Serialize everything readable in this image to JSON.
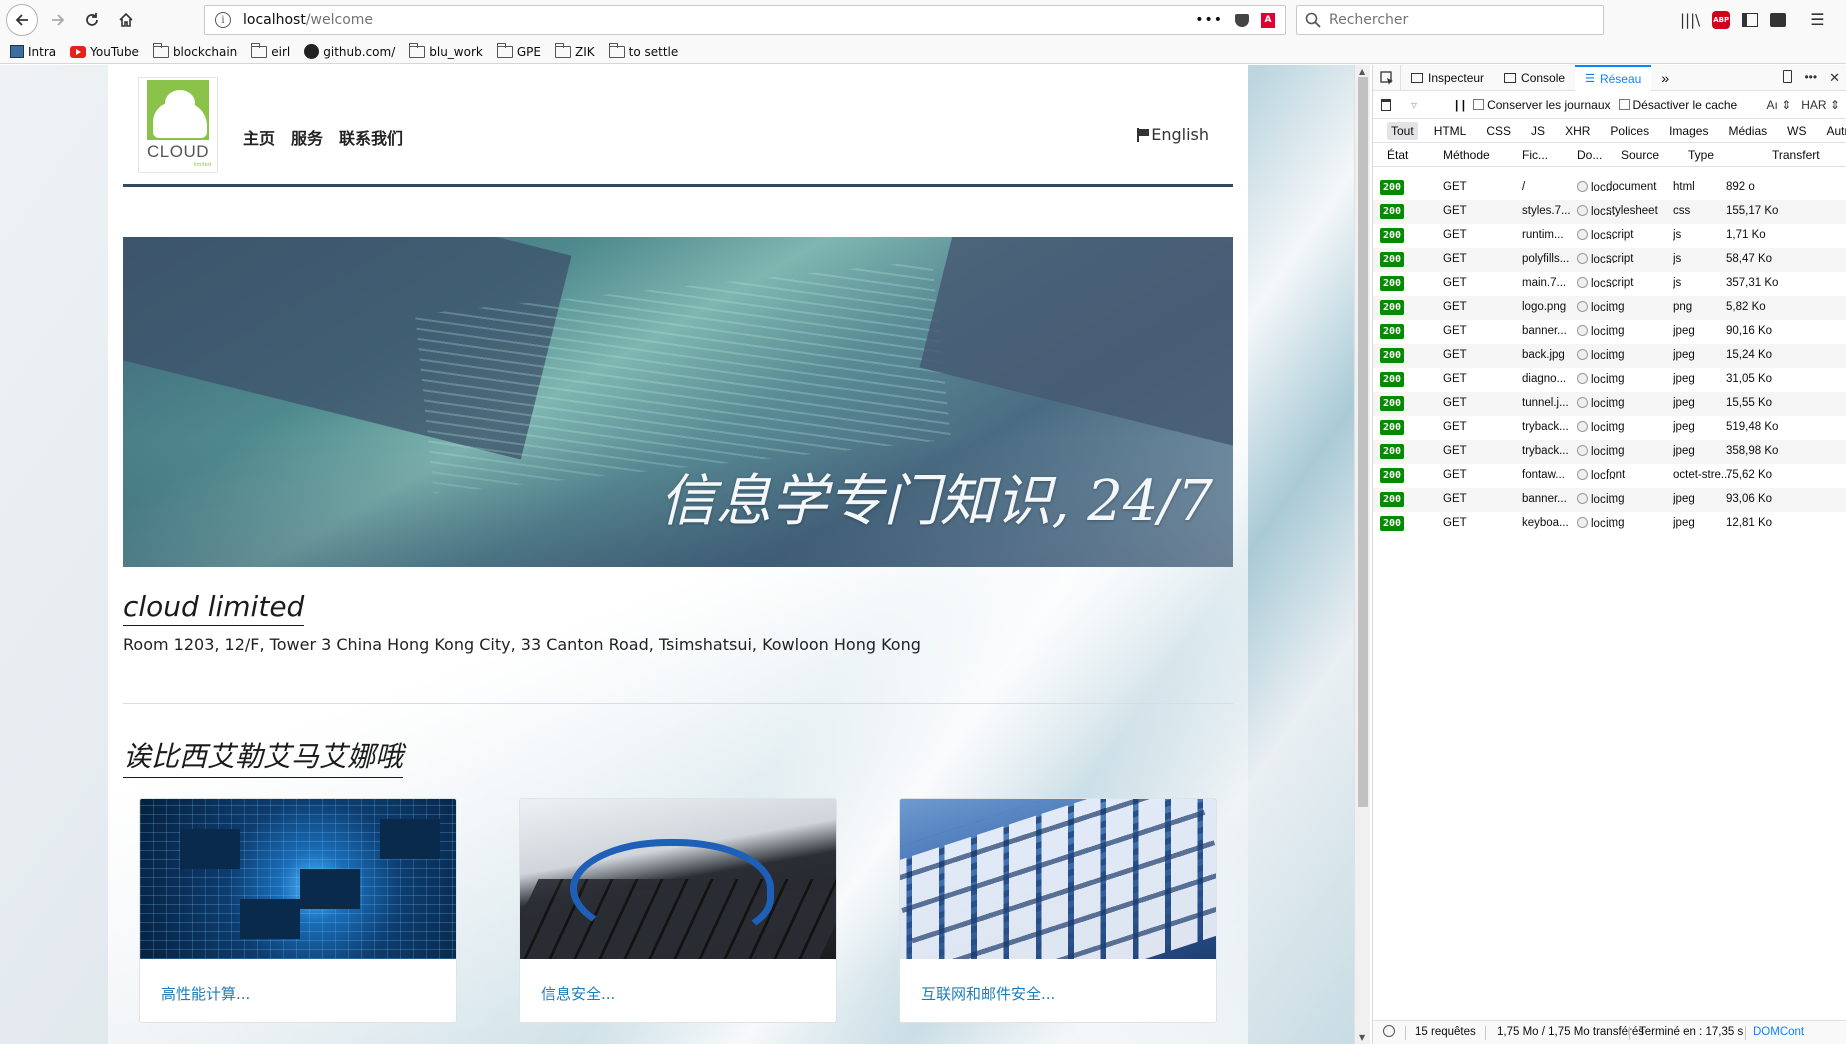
{
  "browser": {
    "url_host": "localhost",
    "url_path": "/welcome",
    "search_placeholder": "Rechercher",
    "bookmarks": [
      "Intra",
      "YouTube",
      "blockchain",
      "eirl",
      "github.com/",
      "blu_work",
      "GPE",
      "ZIK",
      "to settle"
    ],
    "abp_label": "ABP"
  },
  "site": {
    "logo_text": "CLOUD",
    "logo_sub": "limited",
    "nav": [
      "主页",
      "服务",
      "联系我们"
    ],
    "language_link": "English",
    "banner_caption": "信息学专门知识, 24/7",
    "company_name": "cloud limited",
    "company_address": "Room 1203, 12/F, Tower 3 China Hong Kong City, 33 Canton Road, Tsimshatsui, Kowloon Hong Kong",
    "services_title": "诶比西艾勒艾马艾娜哦",
    "cards": [
      {
        "link": "高性能计算..."
      },
      {
        "link": "信息安全..."
      },
      {
        "link": "互联网和邮件安全..."
      }
    ]
  },
  "devtools": {
    "tabs": [
      "Inspecteur",
      "Console",
      "Réseau"
    ],
    "filters": {
      "persist_logs": "Conserver les journaux",
      "disable_cache": "Désactiver le cache",
      "throttle": "Aı",
      "har": "HAR"
    },
    "types": [
      "Tout",
      "HTML",
      "CSS",
      "JS",
      "XHR",
      "Polices",
      "Images",
      "Médias",
      "WS",
      "Autre"
    ],
    "columns": [
      "État",
      "Méthode",
      "Fic...",
      "Do...",
      "Source",
      "Type",
      "Transfert"
    ],
    "requests": [
      {
        "status": "200",
        "method": "GET",
        "file": "/",
        "domain": "loc...",
        "cause": "document",
        "type": "html",
        "size": "892 o"
      },
      {
        "status": "200",
        "method": "GET",
        "file": "styles.7...",
        "domain": "loc...",
        "cause": "stylesheet",
        "type": "css",
        "size": "155,17 Ko"
      },
      {
        "status": "200",
        "method": "GET",
        "file": "runtim...",
        "domain": "loc...",
        "cause": "script",
        "type": "js",
        "size": "1,71 Ko"
      },
      {
        "status": "200",
        "method": "GET",
        "file": "polyfills...",
        "domain": "loc...",
        "cause": "script",
        "type": "js",
        "size": "58,47 Ko"
      },
      {
        "status": "200",
        "method": "GET",
        "file": "main.7...",
        "domain": "loc...",
        "cause": "script",
        "type": "js",
        "size": "357,31 Ko"
      },
      {
        "status": "200",
        "method": "GET",
        "file": "logo.png",
        "domain": "loc...",
        "cause": "img",
        "type": "png",
        "size": "5,82 Ko"
      },
      {
        "status": "200",
        "method": "GET",
        "file": "banner...",
        "domain": "loc...",
        "cause": "img",
        "type": "jpeg",
        "size": "90,16 Ko"
      },
      {
        "status": "200",
        "method": "GET",
        "file": "back.jpg",
        "domain": "loc...",
        "cause": "img",
        "type": "jpeg",
        "size": "15,24 Ko"
      },
      {
        "status": "200",
        "method": "GET",
        "file": "diagno...",
        "domain": "loc...",
        "cause": "img",
        "type": "jpeg",
        "size": "31,05 Ko"
      },
      {
        "status": "200",
        "method": "GET",
        "file": "tunnel.j...",
        "domain": "loc...",
        "cause": "img",
        "type": "jpeg",
        "size": "15,55 Ko"
      },
      {
        "status": "200",
        "method": "GET",
        "file": "tryback...",
        "domain": "loc...",
        "cause": "img",
        "type": "jpeg",
        "size": "519,48 Ko"
      },
      {
        "status": "200",
        "method": "GET",
        "file": "tryback...",
        "domain": "loc...",
        "cause": "img",
        "type": "jpeg",
        "size": "358,98 Ko"
      },
      {
        "status": "200",
        "method": "GET",
        "file": "fontaw...",
        "domain": "loc...",
        "cause": "font",
        "type": "octet-stre...",
        "size": "75,62 Ko"
      },
      {
        "status": "200",
        "method": "GET",
        "file": "banner...",
        "domain": "loc...",
        "cause": "img",
        "type": "jpeg",
        "size": "93,06 Ko"
      },
      {
        "status": "200",
        "method": "GET",
        "file": "keyboa...",
        "domain": "loc...",
        "cause": "img",
        "type": "jpeg",
        "size": "12,81 Ko"
      }
    ],
    "footer": {
      "requests": "15 requêtes",
      "transferred": "1,75 Mo / 1,75 Mo transférés",
      "finished": "Terminé en : 17,35 s",
      "domcontent": "DOMCont"
    }
  },
  "colors": {
    "status_ok": "#058b00",
    "active_tab": "#0a84ff",
    "card_link": "#1e7db6",
    "header_rule": "#34495e"
  }
}
